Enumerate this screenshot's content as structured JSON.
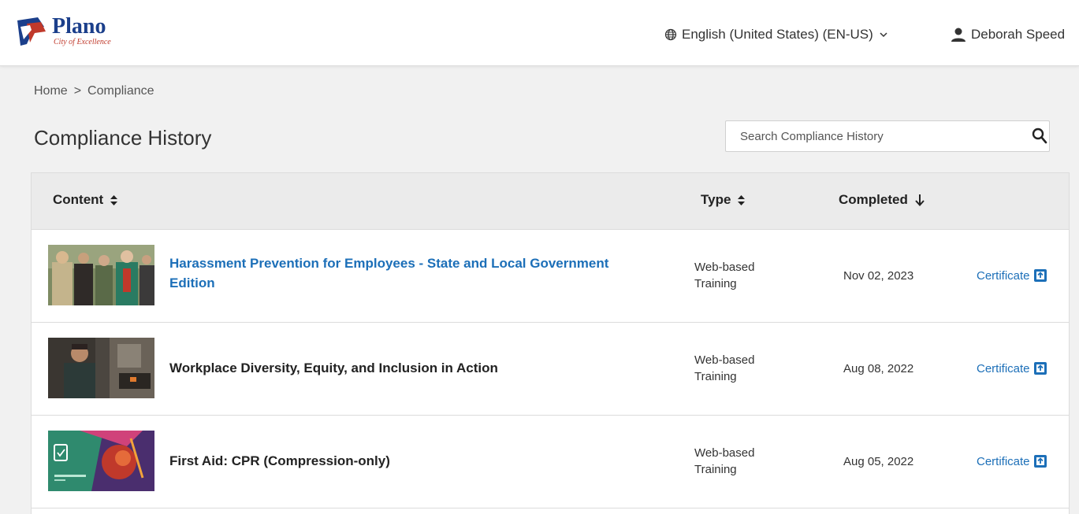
{
  "header": {
    "logo": {
      "name": "Plano",
      "tagline": "City of Excellence"
    },
    "language": "English (United States) (EN-US)",
    "user_name": "Deborah Speed",
    "colors": {
      "logo_blue": "#1b3f8b",
      "logo_red": "#c0392b"
    }
  },
  "breadcrumb": {
    "home": "Home",
    "separator": ">",
    "current": "Compliance"
  },
  "page": {
    "title": "Compliance History"
  },
  "search": {
    "placeholder": "Search Compliance History",
    "value": ""
  },
  "table": {
    "columns": {
      "content": "Content",
      "type": "Type",
      "completed": "Completed"
    },
    "rows": [
      {
        "title": "Harassment Prevention for Employees - State and Local Government Edition",
        "type_line1": "Web-based",
        "type_line2": "Training",
        "completed": "Nov 02, 2023",
        "certificate": "Certificate",
        "thumbnail": "group-of-employees-photo"
      },
      {
        "title": "Workplace Diversity, Equity, and Inclusion in Action",
        "type_line1": "Web-based",
        "type_line2": "Training",
        "completed": "Aug 08, 2022",
        "certificate": "Certificate",
        "thumbnail": "presenter-in-warehouse-photo"
      },
      {
        "title": "First Aid: CPR (Compression-only)",
        "type_line1": "Web-based",
        "type_line2": "Training",
        "completed": "Aug 05, 2022",
        "certificate": "Certificate",
        "thumbnail": "heart-illustration-card"
      }
    ]
  },
  "icons": {
    "globe": "globe-icon",
    "chevron": "chevron-down-icon",
    "user": "user-icon",
    "search": "search-icon",
    "sort": "sort-icon",
    "sort_desc": "arrow-down-icon",
    "certificate": "open-external-icon"
  },
  "colors": {
    "link": "#1c6fb8",
    "header_row": "#ebebeb",
    "page_bg": "#f1f1f1"
  }
}
